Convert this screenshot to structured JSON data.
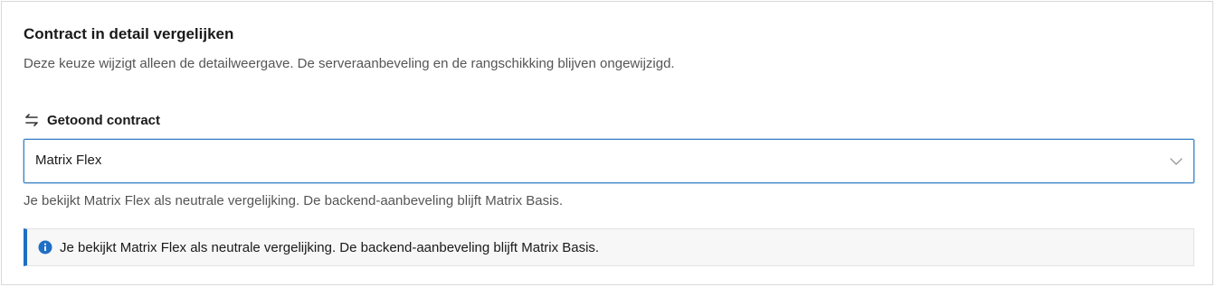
{
  "section": {
    "title": "Contract in detail vergelijken",
    "description": "Deze keuze wijzigt alleen de detailweergave. De serveraanbeveling en de rangschikking blijven ongewijzigd."
  },
  "contract_select": {
    "label": "Getoond contract",
    "label_icon": "swap-arrows-icon",
    "selected_value": "Matrix Flex",
    "dropdown_icon": "chevron-down-icon"
  },
  "helper_text": "Je bekijkt Matrix Flex als neutrale vergelijking. De backend-aanbeveling blijft Matrix Basis.",
  "notice": {
    "icon": "info-icon",
    "text": "Je bekijkt Matrix Flex als neutrale vergelijking. De backend-aanbeveling blijft Matrix Basis."
  },
  "colors": {
    "focus_border": "#3b82c4",
    "notice_accent": "#1f6fc4",
    "notice_background": "#f7f7f7",
    "muted_text": "#555555"
  }
}
